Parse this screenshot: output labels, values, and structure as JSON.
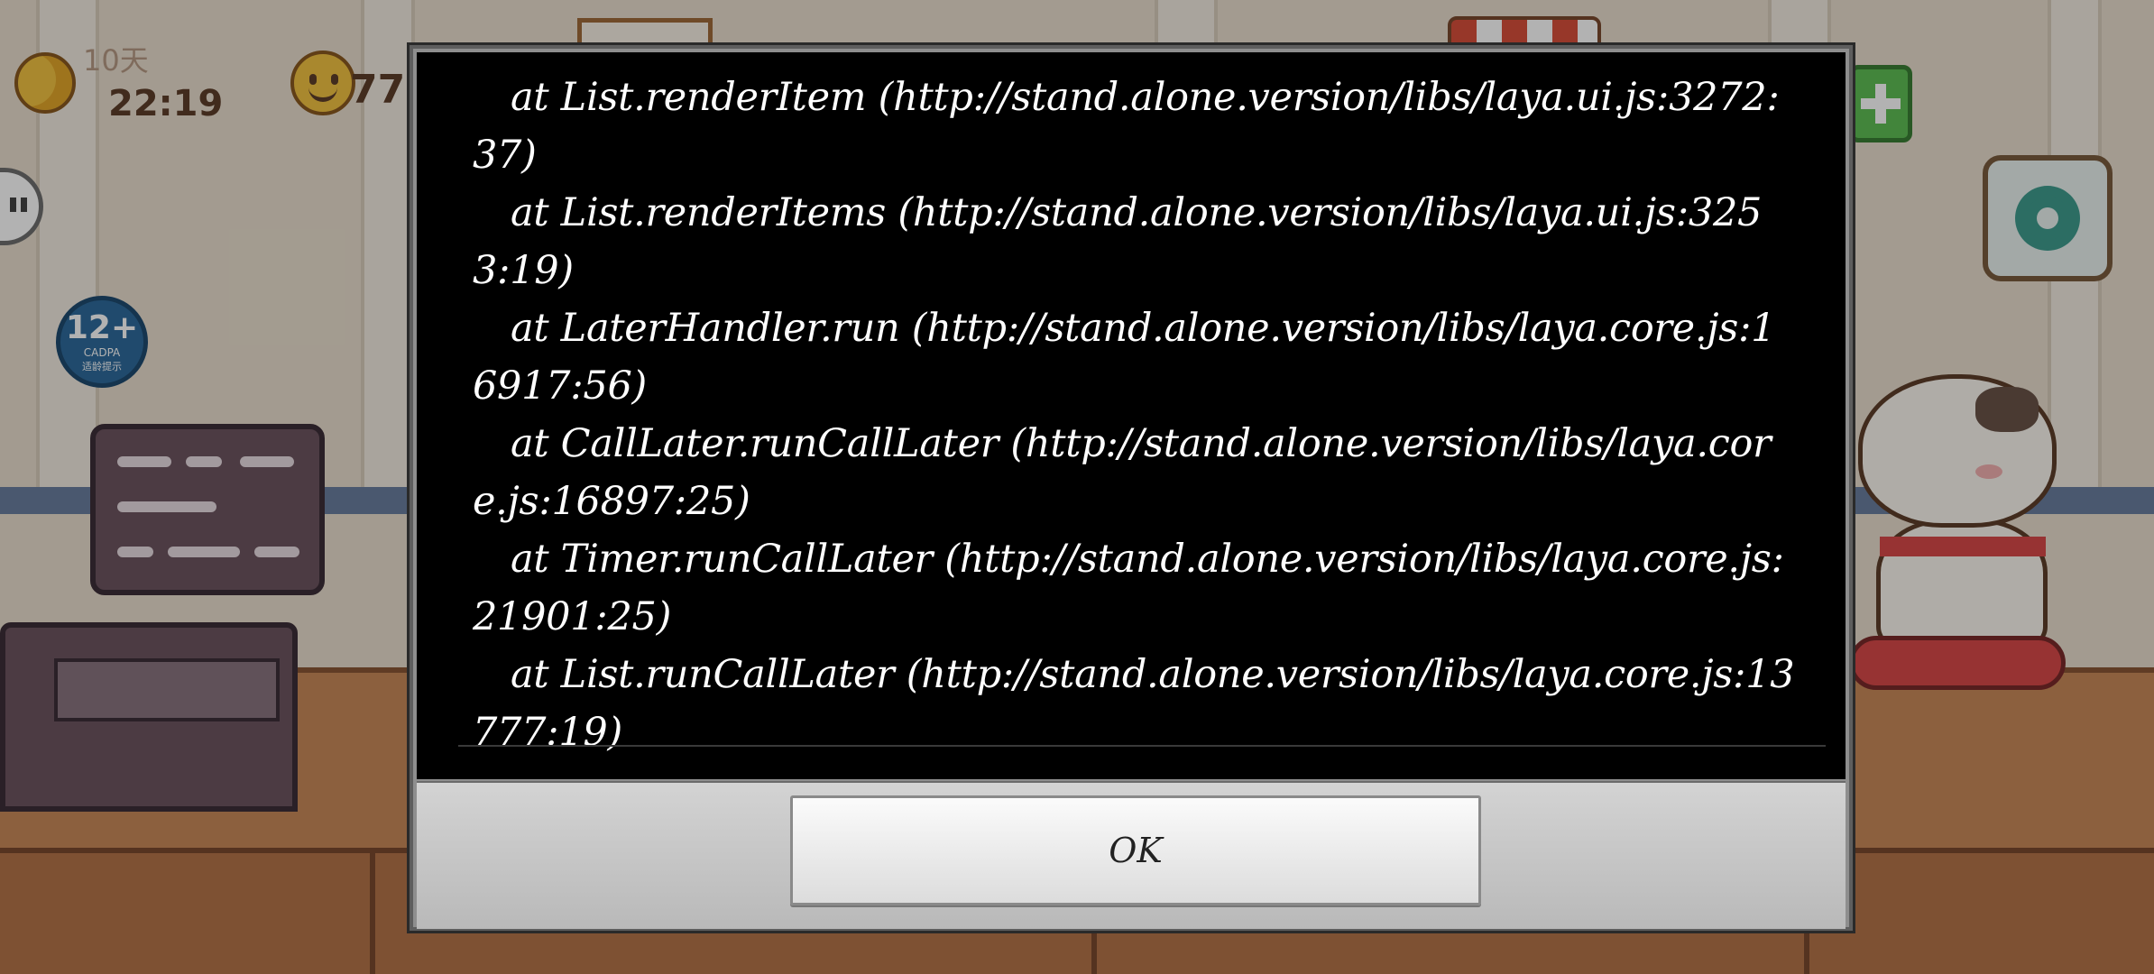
{
  "game": {
    "day": "10天",
    "time": "22:19",
    "smile_count": "77",
    "age_rating": {
      "value": "12+",
      "org": "CADPA",
      "tip": "适龄提示"
    }
  },
  "dialog": {
    "trace_lines": [
      "at List.renderItem (http://stand.alone.version/libs/laya.ui.js:3272:37)",
      "at List.renderItems (http://stand.alone.version/libs/laya.ui.js:3253:19)",
      "at LaterHandler.run (http://stand.alone.version/libs/laya.core.js:16917:56)",
      "at CallLater.runCallLater (http://stand.alone.version/libs/laya.core.js:16897:25)",
      "at Timer.runCallLater (http://stand.alone.version/libs/laya.core.js:21901:25)",
      "at List.runCallLater (http://stand.alone.version/libs/laya.core.js:13777:19)"
    ],
    "ok_label": "OK"
  }
}
